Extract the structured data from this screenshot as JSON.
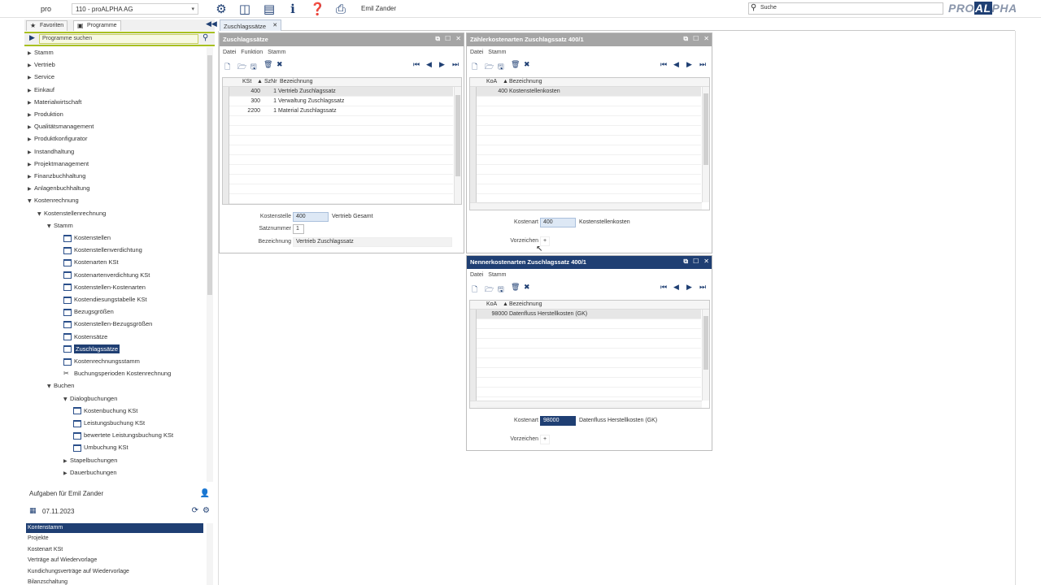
{
  "topbar": {
    "logo": "pro",
    "company": "110 - proALPHA AG",
    "icons": [
      "gear-icon",
      "split-view-icon",
      "table-icon",
      "info-icon",
      "help-icon",
      "print-icon"
    ],
    "user": "Emil Zander",
    "search_placeholder": "Suche",
    "brand_left": "PRO",
    "brand_box": "AL",
    "brand_right": "PHA"
  },
  "sidebar": {
    "tab_favorites": "Favoriten",
    "tab_programs": "Programme",
    "search_placeholder": "Programme suchen",
    "tree": [
      {
        "label": "Stamm",
        "level": 0,
        "arrow": "right"
      },
      {
        "label": "Vertrieb",
        "level": 0,
        "arrow": "right"
      },
      {
        "label": "Service",
        "level": 0,
        "arrow": "right"
      },
      {
        "label": "Einkauf",
        "level": 0,
        "arrow": "right"
      },
      {
        "label": "Materialwirtschaft",
        "level": 0,
        "arrow": "right"
      },
      {
        "label": "Produktion",
        "level": 0,
        "arrow": "right"
      },
      {
        "label": "Qualitätsmanagement",
        "level": 0,
        "arrow": "right"
      },
      {
        "label": "Produktkonfigurator",
        "level": 0,
        "arrow": "right"
      },
      {
        "label": "Instandhaltung",
        "level": 0,
        "arrow": "right"
      },
      {
        "label": "Projektmanagement",
        "level": 0,
        "arrow": "right"
      },
      {
        "label": "Finanzbuchhaltung",
        "level": 0,
        "arrow": "right"
      },
      {
        "label": "Anlagenbuchhaltung",
        "level": 0,
        "arrow": "right"
      },
      {
        "label": "Kostenrechnung",
        "level": 0,
        "arrow": "down"
      },
      {
        "label": "Kostenstellenrechnung",
        "level": 1,
        "arrow": "down"
      },
      {
        "label": "Stamm",
        "level": 2,
        "arrow": "down"
      },
      {
        "label": "Kostenstellen",
        "level": 3,
        "arrow": "leaf"
      },
      {
        "label": "Kostenstellenverdichtung",
        "level": 3,
        "arrow": "leaf"
      },
      {
        "label": "Kostenarten KSt",
        "level": 3,
        "arrow": "leaf"
      },
      {
        "label": "Kostenartenverdichtung KSt",
        "level": 3,
        "arrow": "leaf"
      },
      {
        "label": "Kostenstellen-Kostenarten",
        "level": 3,
        "arrow": "leaf"
      },
      {
        "label": "Kostendiesungstabelle KSt",
        "level": 3,
        "arrow": "leaf"
      },
      {
        "label": "Bezugsgrößen",
        "level": 3,
        "arrow": "leaf"
      },
      {
        "label": "Kostenstellen-Bezugsgrößen",
        "level": 3,
        "arrow": "leaf"
      },
      {
        "label": "Kostensätze",
        "level": 3,
        "arrow": "leaf"
      },
      {
        "label": "Zuschlagssätze",
        "level": 3,
        "arrow": "leaf",
        "selected": true
      },
      {
        "label": "Kostenrechnungsstamm",
        "level": 3,
        "arrow": "leaf"
      },
      {
        "label": "Buchungsperioden Kostenrechnung",
        "level": 3,
        "arrow": "wrench"
      },
      {
        "label": "Buchen",
        "level": 2,
        "arrow": "down"
      },
      {
        "label": "Dialogbuchungen",
        "level": 3,
        "arrow": "down"
      },
      {
        "label": "Kostenbuchung KSt",
        "level": 4,
        "arrow": "leaf"
      },
      {
        "label": "Leistungsbuchung KSt",
        "level": 4,
        "arrow": "leaf"
      },
      {
        "label": "bewertete Leistungsbuchung KSt",
        "level": 4,
        "arrow": "leaf"
      },
      {
        "label": "Umbuchung KSt",
        "level": 4,
        "arrow": "leaf"
      },
      {
        "label": "Stapelbuchungen",
        "level": 3,
        "arrow": "right"
      },
      {
        "label": "Dauerbuchungen",
        "level": 3,
        "arrow": "right"
      }
    ]
  },
  "tasks": {
    "title": "Aufgaben für Emil Zander",
    "date": "07.11.2023",
    "items": [
      {
        "label": "Kontenstamm",
        "selected": true
      },
      {
        "label": "Projekte"
      },
      {
        "label": "Kostenart KSt"
      },
      {
        "label": "Verträge auf Wiedervorlage"
      },
      {
        "label": "Kundichungsverträge auf Wiedervorlage"
      },
      {
        "label": "Bilanzschaltung"
      }
    ]
  },
  "doc_tab": {
    "label": "Zuschlagssätze"
  },
  "win1": {
    "title": "Zuschlagssätze",
    "menu": [
      "Datei",
      "Funktion",
      "Stamm"
    ],
    "headers": {
      "kst": "KSt",
      "satznr": "SzNr",
      "bez": "Bezeichnung"
    },
    "rows": [
      {
        "kst": "400",
        "satznr": "1",
        "bez": "Vertrieb Zuschlagssatz"
      },
      {
        "kst": "300",
        "satznr": "1",
        "bez": "Verwaltung Zuschlagssatz"
      },
      {
        "kst": "2200",
        "satznr": "1",
        "bez": "Material Zuschlagssatz"
      }
    ],
    "kostenstelle_label": "Kostenstelle",
    "kostenstelle_value": "400",
    "kostenstelle_desc": "Vertrieb Gesamt",
    "satznummer_label": "Satznummer",
    "satznummer_value": "1",
    "bezeichnung_label": "Bezeichnung",
    "bezeichnung_value": "Vertrieb Zuschlagssatz"
  },
  "win2": {
    "title": "Zählerkostenarten Zuschlagssatz 400/1",
    "menu": [
      "Datei",
      "Stamm"
    ],
    "headers": {
      "koa": "KoA",
      "bez": "Bezeichnung"
    },
    "rows": [
      {
        "koa": "400",
        "bez": "Kostenstellenkosten"
      }
    ],
    "kostenart_label": "Kostenart",
    "kostenart_value": "400",
    "kostenart_desc": "Kostenstellenkosten",
    "vorzeichen_label": "Vorzeichen",
    "vorzeichen_value": "+"
  },
  "win3": {
    "title": "Nennerkostenarten Zuschlagssatz 400/1",
    "menu": [
      "Datei",
      "Stamm"
    ],
    "headers": {
      "koa": "KoA",
      "bez": "Bezeichnung"
    },
    "rows": [
      {
        "koa": "98000",
        "bez": "Datenfluss Herstellkosten (GK)"
      }
    ],
    "kostenart_label": "Kostenart",
    "kostenart_value": "98000",
    "kostenart_desc": "Datenfluss Herstellkosten (GK)",
    "vorzeichen_label": "Vorzeichen",
    "vorzeichen_value": "+"
  },
  "colors": {
    "accent": "#1f3f73",
    "green": "#a8c020",
    "title_gray": "#a5a5a5"
  }
}
